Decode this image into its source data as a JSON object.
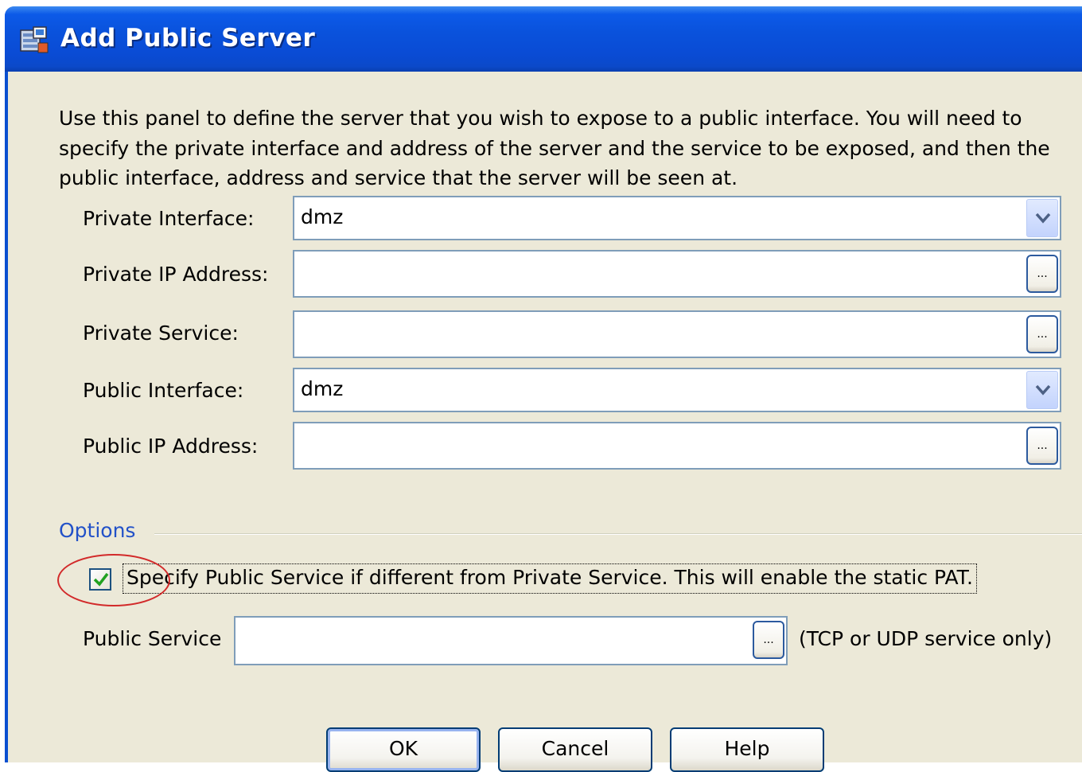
{
  "window": {
    "title": "Add Public Server",
    "icon": "server-app-icon"
  },
  "description": "Use this panel to define the server that you wish to expose to a public interface. You will need to specify the private interface and address of the server and the service to be exposed, and then the public interface, address and service that the server will be seen at.",
  "fields": {
    "private_interface": {
      "label": "Private Interface:",
      "value": "dmz"
    },
    "private_ip": {
      "label": "Private IP Address:",
      "value": "",
      "browse_label": "..."
    },
    "private_service": {
      "label": "Private Service:",
      "value": "",
      "browse_label": "..."
    },
    "public_interface": {
      "label": "Public Interface:",
      "value": "dmz"
    },
    "public_ip": {
      "label": "Public IP Address:",
      "value": "",
      "browse_label": "..."
    }
  },
  "options": {
    "group_label": "Options",
    "checkbox_label": "Specify Public Service if different from Private Service.  This will enable the static PAT.",
    "checkbox_checked": true,
    "public_service_label": "Public Service",
    "public_service_value": "",
    "public_service_browse_label": "...",
    "public_service_hint": "(TCP or UDP service only)"
  },
  "buttons": {
    "ok": "OK",
    "cancel": "Cancel",
    "help": "Help"
  },
  "colors": {
    "titlebar": "#0a52dc",
    "dialog_bg": "#ece9d8",
    "options_label": "#2251c8",
    "highlight_ellipse": "#d22a2a",
    "checkmark": "#21a121"
  }
}
